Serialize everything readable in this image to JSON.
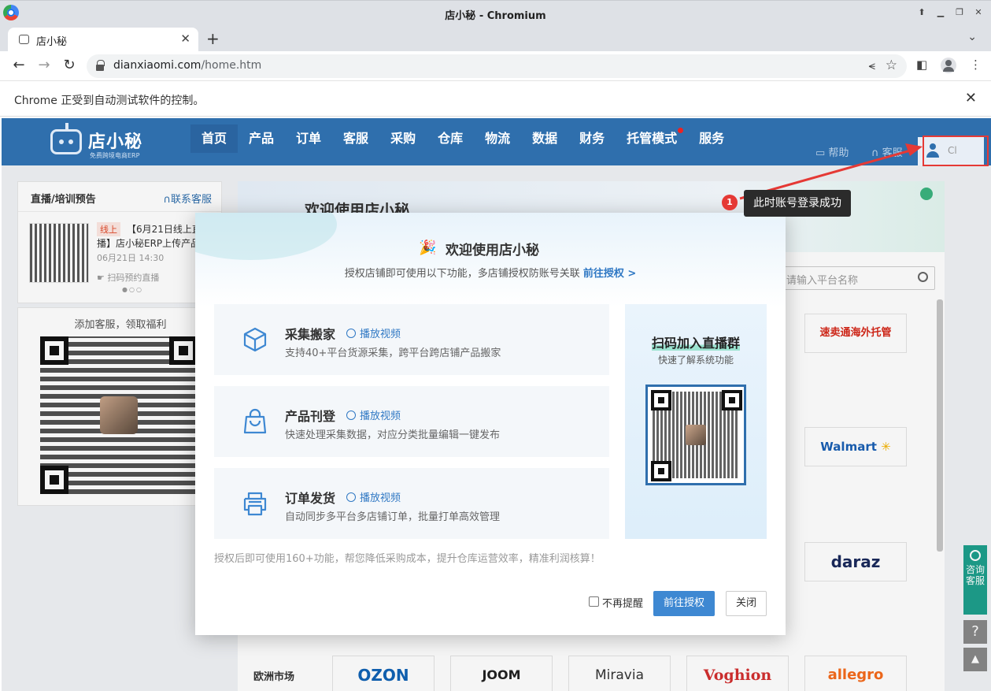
{
  "browser": {
    "window_title": "店小秘 - Chromium",
    "tab_title": "店小秘",
    "url_host": "dianxiaomi.com",
    "url_path": "/home.htm",
    "infobar_message": "Chrome 正受到自动测试软件的控制。"
  },
  "site": {
    "logo_name": "店小秘",
    "logo_sub": "免费跨境电商ERP",
    "nav": [
      "首页",
      "产品",
      "订单",
      "客服",
      "采购",
      "仓库",
      "物流",
      "数据",
      "财务",
      "托管模式",
      "服务"
    ],
    "nav_active_index": 0,
    "nav_dot_index": 9,
    "help": "帮助",
    "customer_service": "客服",
    "username": "Cl"
  },
  "left_panel": {
    "card_title": "直播/培训预告",
    "card_link": "联系客服",
    "event_tag": "线上",
    "event_title_line1": "【6月21日线上直",
    "event_title_line2": "播】店小秘ERP上传产品",
    "event_date": "06月21日 14:30",
    "scan_text": "扫码预约直播",
    "dots": "●○○",
    "welfare_title": "添加客服，领取福利"
  },
  "main": {
    "banner_title": "欢迎使用店小秘",
    "search_placeholder": "请输入平台名称",
    "eu_label": "欧洲市场",
    "platforms_right": [
      "速卖通海外托管",
      "Walmart",
      "daraz"
    ],
    "platforms_eu": [
      "OZON",
      "JOOM",
      "Miravia",
      "Voghion",
      "allegro"
    ]
  },
  "floating": {
    "consult": "咨询客服",
    "help": "?",
    "top": "▲"
  },
  "modal": {
    "title": "欢迎使用店小秘",
    "subtitle": "授权店铺即可使用以下功能，多店铺授权防账号关联",
    "subtitle_link": "前往授权 >",
    "features": [
      {
        "title": "采集搬家",
        "play": "播放视频",
        "desc": "支持40+平台货源采集，跨平台跨店铺产品搬家",
        "icon": "cube-icon"
      },
      {
        "title": "产品刊登",
        "play": "播放视频",
        "desc": "快速处理采集数据，对应分类批量编辑一键发布",
        "icon": "shopping-bag-icon"
      },
      {
        "title": "订单发货",
        "play": "播放视频",
        "desc": "自动同步多平台多店铺订单，批量打单高效管理",
        "icon": "printer-icon"
      }
    ],
    "qr_title": "扫码加入直播群",
    "qr_sub": "快速了解系统功能",
    "note": "授权后即可使用160+功能，帮您降低采购成本，提升仓库运营效率，精准利润核算！",
    "checkbox_label": "不再提醒",
    "primary_button": "前往授权",
    "close_button": "关闭"
  },
  "annotation": {
    "badge": "1",
    "text": "此时账号登录成功",
    "color": "#e53935"
  }
}
